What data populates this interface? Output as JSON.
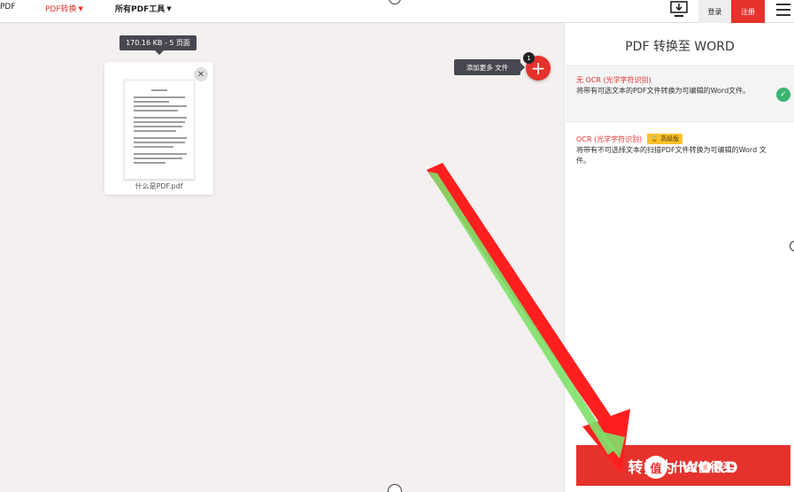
{
  "nav": {
    "logo_text": "PDF",
    "pdf_convert": "PDF转换",
    "all_tools": "所有PDF工具",
    "login": "登录",
    "register": "注册"
  },
  "workspace": {
    "file_size_tooltip": "170.16 KB - 5 页面",
    "file_name": "什么是PDF.pdf",
    "add_more_label": "添加更多 文件",
    "file_count_badge": "1"
  },
  "panel": {
    "title": "PDF 转换至 WORD",
    "options": [
      {
        "title": "无 OCR (光学字符识别)",
        "description": "将带有可选文本的PDF文件转换为可编辑的Word文件。",
        "selected": true
      },
      {
        "title": "OCR (光学字符识别)",
        "premium_label": "高级版",
        "description": "将带有不可选择文本的扫描PDF文件转换为可编辑的Word 文件。",
        "selected": false
      }
    ],
    "convert_button": "转换为 WORD"
  },
  "watermark": {
    "text": "什么值得买",
    "logo_glyph": "值"
  },
  "colors": {
    "accent": "#e5322d",
    "check": "#3cb371",
    "premium": "#fbc12e",
    "arrow_red": "#ff1f1f",
    "arrow_green": "#7fe06a"
  }
}
